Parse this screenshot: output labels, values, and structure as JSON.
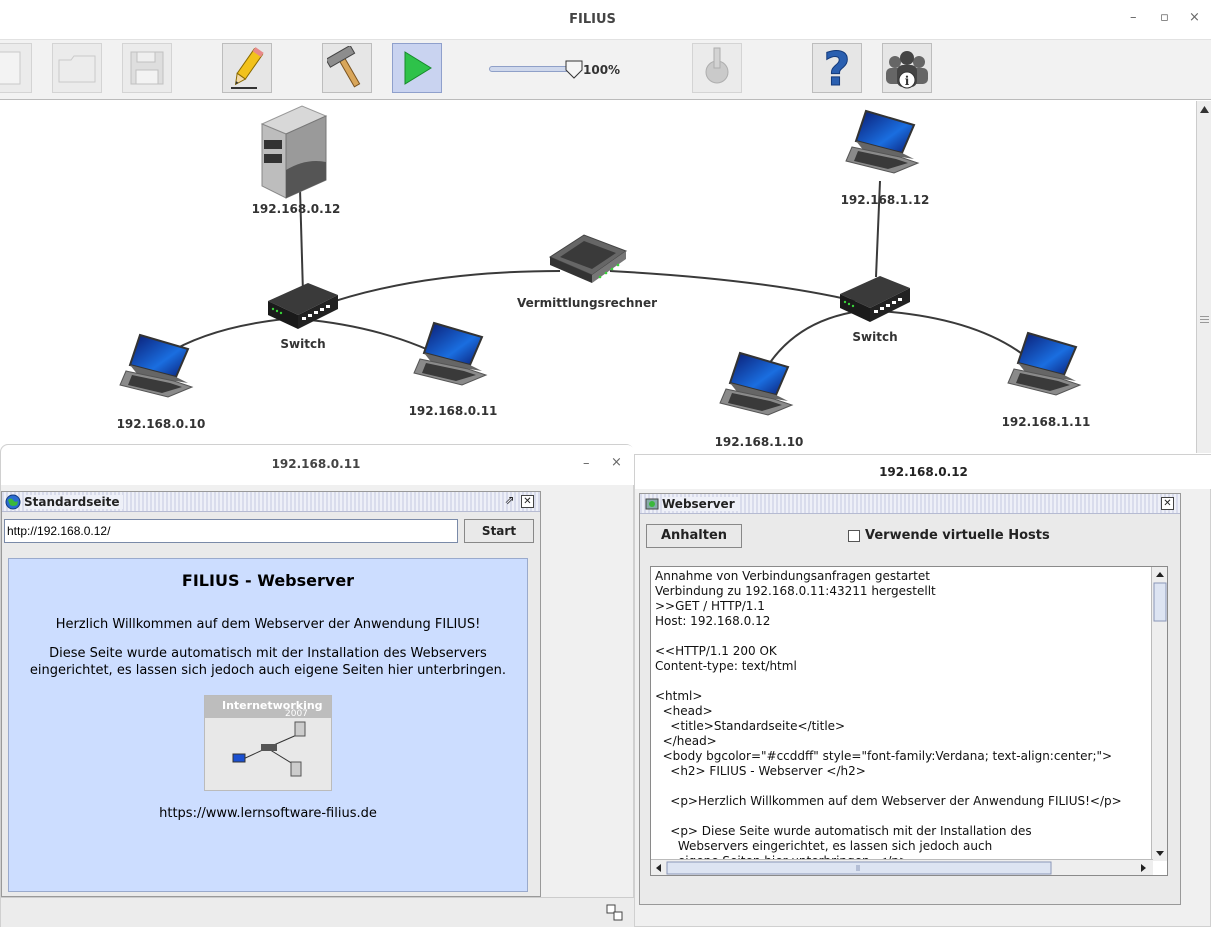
{
  "main": {
    "title": "FILIUS",
    "min": "–",
    "max": "▫",
    "close": "×",
    "zoom": "100%"
  },
  "network": {
    "server_ip": "192.168.0.12",
    "router_label": "Vermittlungsrechner",
    "switch_left": "Switch",
    "switch_right": "Switch",
    "laptop_010": "192.168.0.10",
    "laptop_011": "192.168.0.11",
    "laptop_112": "192.168.1.12",
    "laptop_110": "192.168.1.10",
    "laptop_111": "192.168.1.11"
  },
  "left_window": {
    "title": "192.168.0.11",
    "min": "–",
    "close": "×",
    "inner_title": "Standardseite",
    "url": "http://192.168.0.12/",
    "start": "Start",
    "page_heading": "FILIUS - Webserver",
    "page_p1": "Herzlich Willkommen auf dem Webserver der Anwendung FILIUS!",
    "page_p2": "Diese Seite wurde automatisch mit der Installation des Webservers eingerichtet, es lassen sich jedoch auch eigene Seiten hier unterbringen.",
    "image_text": "Internetworking",
    "image_year": "2007",
    "page_link": "https://www.lernsoftware-filius.de"
  },
  "right_window": {
    "title": "192.168.0.12",
    "inner_title": "Webserver",
    "stop_button": "Anhalten",
    "vhost_label": "Verwende virtuelle Hosts",
    "log": [
      "Annahme von Verbindungsanfragen gestartet",
      "Verbindung zu 192.168.0.11:43211 hergestellt",
      ">>GET / HTTP/1.1",
      "Host: 192.168.0.12",
      "",
      "<<HTTP/1.1 200 OK",
      "Content-type: text/html",
      "",
      "<html>",
      "  <head>",
      "    <title>Standardseite</title>",
      "  </head>",
      "  <body bgcolor=\"#ccddff\" style=\"font-family:Verdana; text-align:center;\">",
      "    <h2> FILIUS - Webserver </h2>",
      "",
      "    <p>Herzlich Willkommen auf dem Webserver der Anwendung FILIUS!</p>",
      "",
      "    <p> Diese Seite wurde automatisch mit der Installation des",
      "      Webservers eingerichtet, es lassen sich jedoch auch",
      "      eigene Seiten hier unterbringen. </p>"
    ]
  },
  "colors": {
    "page_bg": "#ccddff",
    "desktop_blue": "#1f5aa8"
  }
}
